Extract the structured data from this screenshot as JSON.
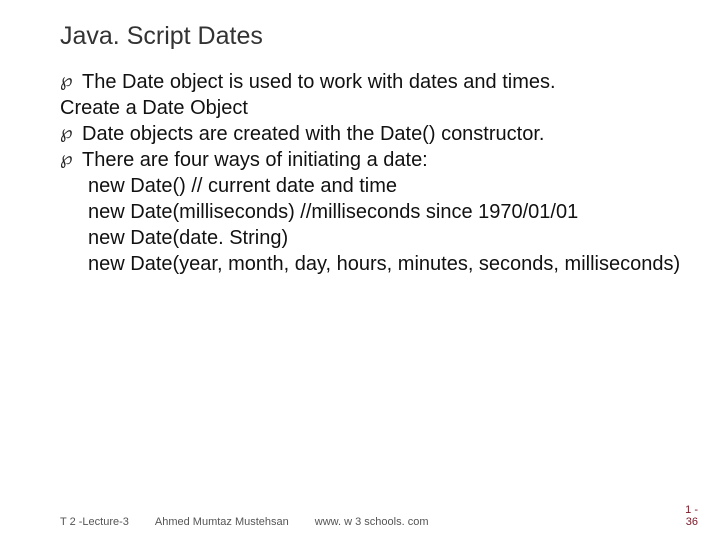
{
  "title": "Java. Script Dates",
  "content": {
    "line1": "The Date object is used to work with dates and times.",
    "line2": "Create a Date Object",
    "line3": "Date objects are created with the Date() constructor.",
    "line4": "There are four ways of initiating a date:",
    "code1": "new Date() // current date and time",
    "code2": "new Date(milliseconds) //milliseconds since 1970/01/01",
    "code3": "new Date(date. String)",
    "code4": "new Date(year, month, day, hours, minutes, seconds, milliseconds)"
  },
  "footer": {
    "lecture": "T 2 -Lecture-3",
    "author": "Ahmed Mumtaz Mustehsan",
    "site": "www. w 3 schools. com",
    "page_top": "1 -",
    "page_bottom": "36"
  }
}
